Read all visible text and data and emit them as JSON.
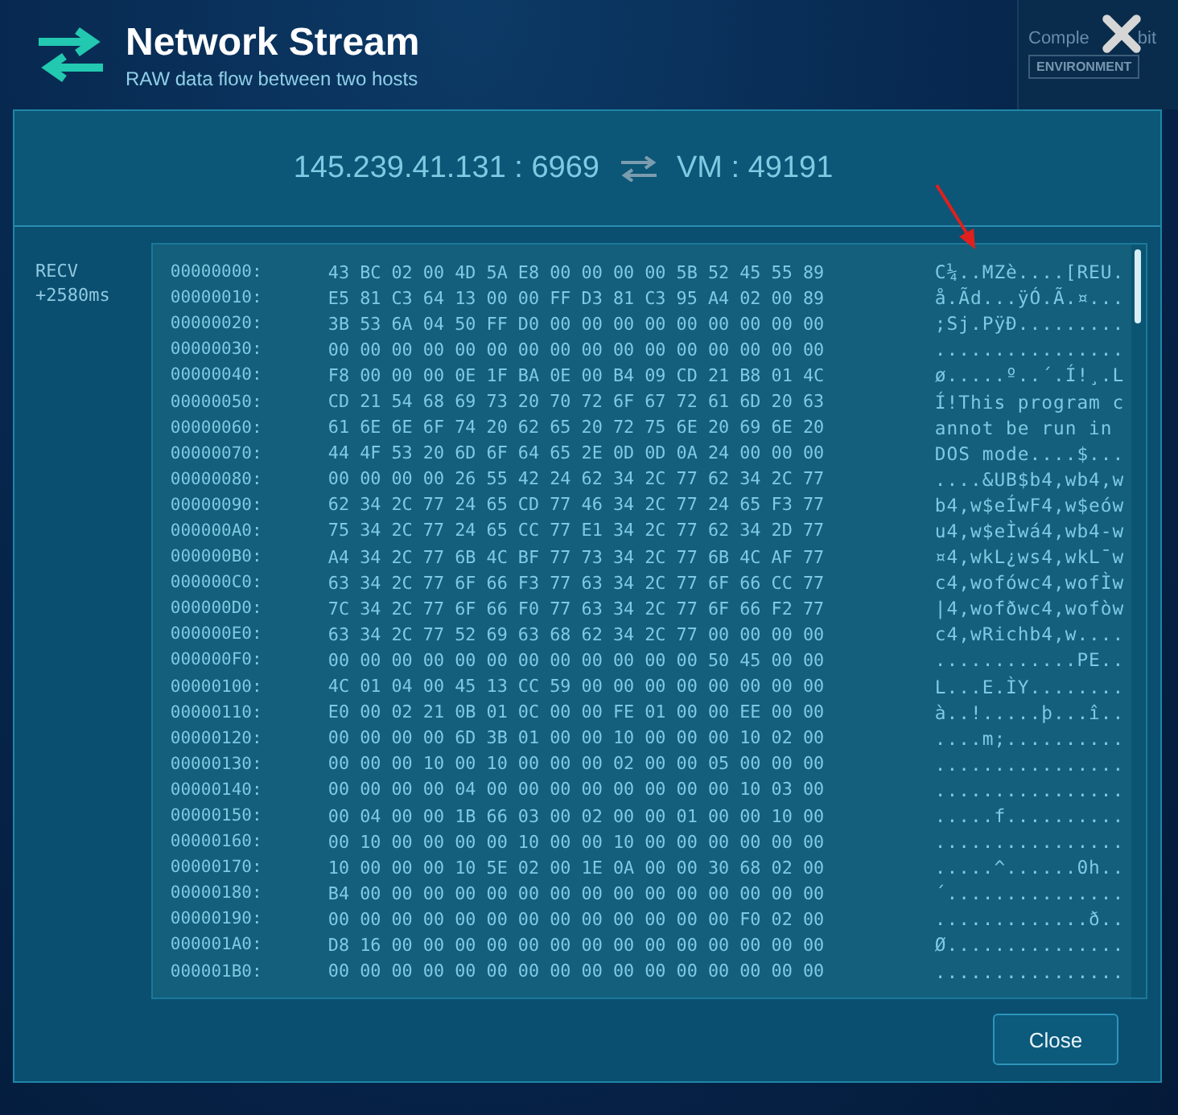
{
  "header": {
    "title": "Network Stream",
    "subtitle": "RAW data flow between two hosts"
  },
  "background": {
    "caption_parts": [
      "Comple",
      "bit"
    ],
    "badge": "ENVIRONMENT"
  },
  "stream": {
    "source": "145.239.41.131 : 6969",
    "destination": "VM : 49191"
  },
  "packet": {
    "direction": "RECV",
    "offset": "+2580ms",
    "rows": [
      {
        "address": "00000000:",
        "hex": "43 BC 02 00 4D 5A E8 00 00 00 00 5B 52 45 55 89",
        "ascii": "C¼..MZè....[REU."
      },
      {
        "address": "00000010:",
        "hex": "E5 81 C3 64 13 00 00 FF D3 81 C3 95 A4 02 00 89",
        "ascii": "å.Ãd...ÿÓ.Ã.¤..."
      },
      {
        "address": "00000020:",
        "hex": "3B 53 6A 04 50 FF D0 00 00 00 00 00 00 00 00 00",
        "ascii": ";Sj.PÿÐ........."
      },
      {
        "address": "00000030:",
        "hex": "00 00 00 00 00 00 00 00 00 00 00 00 00 00 00 00",
        "ascii": "................"
      },
      {
        "address": "00000040:",
        "hex": "F8 00 00 00 0E 1F BA 0E 00 B4 09 CD 21 B8 01 4C",
        "ascii": "ø.....º..´.Í!¸.L"
      },
      {
        "address": "00000050:",
        "hex": "CD 21 54 68 69 73 20 70 72 6F 67 72 61 6D 20 63",
        "ascii": "Í!This program c"
      },
      {
        "address": "00000060:",
        "hex": "61 6E 6E 6F 74 20 62 65 20 72 75 6E 20 69 6E 20",
        "ascii": "annot be run in "
      },
      {
        "address": "00000070:",
        "hex": "44 4F 53 20 6D 6F 64 65 2E 0D 0D 0A 24 00 00 00",
        "ascii": "DOS mode....$..."
      },
      {
        "address": "00000080:",
        "hex": "00 00 00 00 26 55 42 24 62 34 2C 77 62 34 2C 77",
        "ascii": "....&UB$b4,wb4,w"
      },
      {
        "address": "00000090:",
        "hex": "62 34 2C 77 24 65 CD 77 46 34 2C 77 24 65 F3 77",
        "ascii": "b4,w$eÍwF4,w$eów"
      },
      {
        "address": "000000A0:",
        "hex": "75 34 2C 77 24 65 CC 77 E1 34 2C 77 62 34 2D 77",
        "ascii": "u4,w$eÌwá4,wb4-w"
      },
      {
        "address": "000000B0:",
        "hex": "A4 34 2C 77 6B 4C BF 77 73 34 2C 77 6B 4C AF 77",
        "ascii": "¤4,wkL¿ws4,wkL¯w"
      },
      {
        "address": "000000C0:",
        "hex": "63 34 2C 77 6F 66 F3 77 63 34 2C 77 6F 66 CC 77",
        "ascii": "c4,wofówc4,wofÌw"
      },
      {
        "address": "000000D0:",
        "hex": "7C 34 2C 77 6F 66 F0 77 63 34 2C 77 6F 66 F2 77",
        "ascii": "|4,wofðwc4,wofòw"
      },
      {
        "address": "000000E0:",
        "hex": "63 34 2C 77 52 69 63 68 62 34 2C 77 00 00 00 00",
        "ascii": "c4,wRichb4,w...."
      },
      {
        "address": "000000F0:",
        "hex": "00 00 00 00 00 00 00 00 00 00 00 00 50 45 00 00",
        "ascii": "............PE.."
      },
      {
        "address": "00000100:",
        "hex": "4C 01 04 00 45 13 CC 59 00 00 00 00 00 00 00 00",
        "ascii": "L...E.ÌY........"
      },
      {
        "address": "00000110:",
        "hex": "E0 00 02 21 0B 01 0C 00 00 FE 01 00 00 EE 00 00",
        "ascii": "à..!.....þ...î.."
      },
      {
        "address": "00000120:",
        "hex": "00 00 00 00 6D 3B 01 00 00 10 00 00 00 10 02 00",
        "ascii": "....m;.........."
      },
      {
        "address": "00000130:",
        "hex": "00 00 00 10 00 10 00 00 00 02 00 00 05 00 00 00",
        "ascii": "................"
      },
      {
        "address": "00000140:",
        "hex": "00 00 00 00 04 00 00 00 00 00 00 00 00 10 03 00",
        "ascii": "................"
      },
      {
        "address": "00000150:",
        "hex": "00 04 00 00 1B 66 03 00 02 00 00 01 00 00 10 00",
        "ascii": ".....f.........."
      },
      {
        "address": "00000160:",
        "hex": "00 10 00 00 00 00 10 00 00 10 00 00 00 00 00 00",
        "ascii": "................"
      },
      {
        "address": "00000170:",
        "hex": "10 00 00 00 10 5E 02 00 1E 0A 00 00 30 68 02 00",
        "ascii": ".....^......0h.."
      },
      {
        "address": "00000180:",
        "hex": "B4 00 00 00 00 00 00 00 00 00 00 00 00 00 00 00",
        "ascii": "´..............."
      },
      {
        "address": "00000190:",
        "hex": "00 00 00 00 00 00 00 00 00 00 00 00 00 F0 02 00",
        "ascii": ".............ð.."
      },
      {
        "address": "000001A0:",
        "hex": "D8 16 00 00 00 00 00 00 00 00 00 00 00 00 00 00",
        "ascii": "Ø..............."
      },
      {
        "address": "000001B0:",
        "hex": "00 00 00 00 00 00 00 00 00 00 00 00 00 00 00 00",
        "ascii": "................"
      }
    ]
  },
  "buttons": [
    {
      "label": "Close"
    }
  ]
}
